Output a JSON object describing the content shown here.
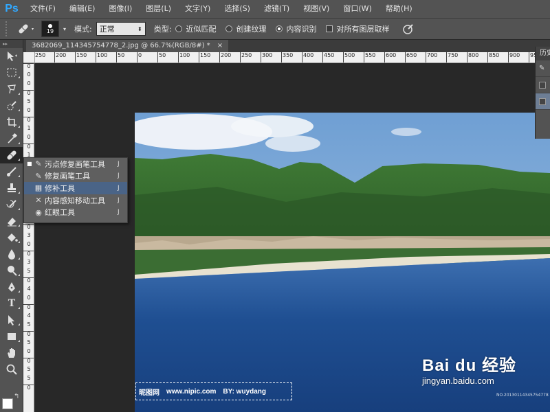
{
  "app": {
    "logo": "Ps"
  },
  "menu": [
    "文件(F)",
    "编辑(E)",
    "图像(I)",
    "图层(L)",
    "文字(Y)",
    "选择(S)",
    "滤镜(T)",
    "视图(V)",
    "窗口(W)",
    "帮助(H)"
  ],
  "options": {
    "brush_size": "19",
    "mode_label": "模式:",
    "mode_value": "正常",
    "type_label": "类型:",
    "radio_near": "近似匹配",
    "radio_texture": "创建纹理",
    "radio_content": "内容识别",
    "checkbox_all_layers": "对所有图层取样"
  },
  "document": {
    "tab_title": "3682069_114345754778_2.jpg @ 66.7%(RGB/8#) *",
    "close": "×"
  },
  "ruler": {
    "h": [
      "250",
      "200",
      "150",
      "100",
      "50",
      "0",
      "50",
      "100",
      "150",
      "200",
      "250",
      "300",
      "350",
      "400",
      "450",
      "500",
      "550",
      "600",
      "650",
      "700",
      "750",
      "800",
      "850",
      "900",
      "950"
    ],
    "v": [
      "0",
      "0",
      "0",
      "0",
      "5",
      "0",
      "0",
      "1",
      "0",
      "0",
      "1",
      "5",
      "0",
      "2",
      "0",
      "0",
      "2",
      "5",
      "0",
      "3",
      "0",
      "0",
      "3",
      "5",
      "0",
      "4",
      "0",
      "0",
      "4",
      "5",
      "0",
      "5",
      "0",
      "0",
      "5",
      "5",
      "0"
    ]
  },
  "flyout": {
    "items": [
      {
        "label": "污点修复画笔工具",
        "key": "J",
        "icon": "spot-healing-brush-icon",
        "selected": true
      },
      {
        "label": "修复画笔工具",
        "key": "J",
        "icon": "healing-brush-icon",
        "selected": false
      },
      {
        "label": "修补工具",
        "key": "J",
        "icon": "patch-tool-icon",
        "selected": false
      },
      {
        "label": "内容感知移动工具",
        "key": "J",
        "icon": "content-aware-move-icon",
        "selected": false
      },
      {
        "label": "红眼工具",
        "key": "J",
        "icon": "red-eye-icon",
        "selected": false
      }
    ],
    "hover_index": 2
  },
  "history": {
    "title": "历史"
  },
  "watermark": {
    "left_site": "昵图网",
    "left_url": "www.nipic.com",
    "left_by": "BY: wuydang",
    "baidu_logo": "Bai du 经验",
    "baidu_url": "jingyan.baidu.com",
    "image_id": "NO.20130114345754778"
  }
}
